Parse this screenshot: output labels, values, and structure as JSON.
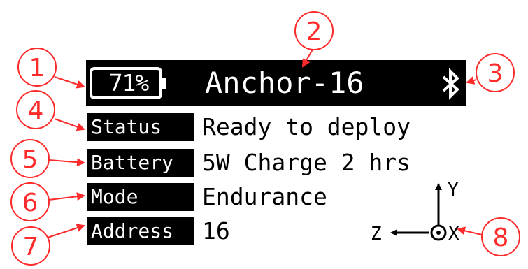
{
  "header": {
    "battery_percent": "71%",
    "title": "Anchor-16",
    "bluetooth_icon": "bluetooth-icon"
  },
  "rows": [
    {
      "label": "Status",
      "value": "Ready to deploy"
    },
    {
      "label": "Battery",
      "value": "5W Charge 2 hrs"
    },
    {
      "label": "Mode",
      "value": "Endurance"
    },
    {
      "label": "Address",
      "value": "16"
    }
  ],
  "axes": {
    "y": "Y",
    "z": "Z",
    "x": "X"
  },
  "callouts": [
    "1",
    "2",
    "3",
    "4",
    "5",
    "6",
    "7",
    "8"
  ],
  "colors": {
    "callout": "#ff2a2a",
    "screen": "#000000",
    "text": "#ffffff"
  }
}
